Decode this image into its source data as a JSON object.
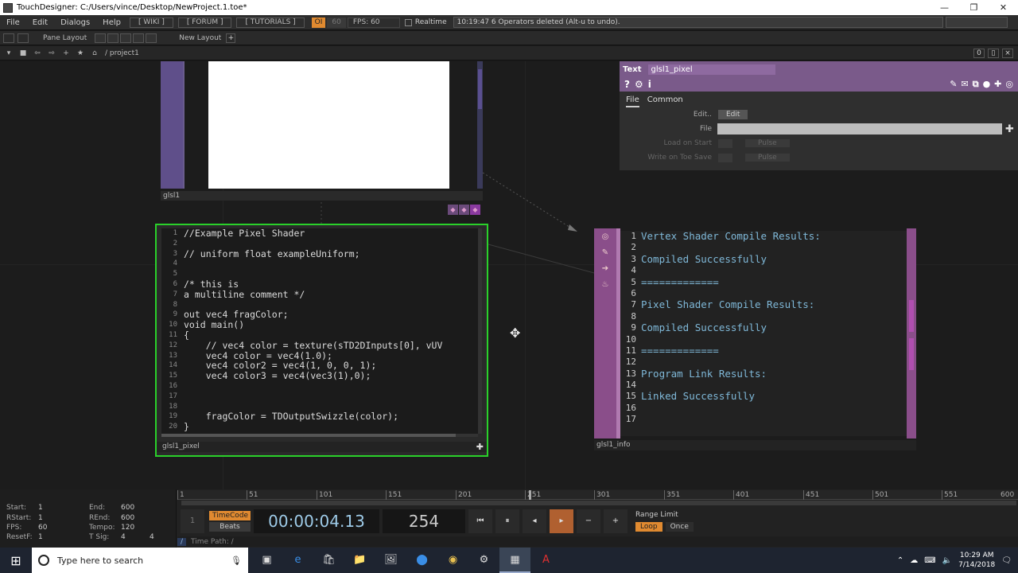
{
  "window": {
    "title": "TouchDesigner: C:/Users/vince/Desktop/NewProject.1.toe*",
    "controls": [
      "—",
      "❐",
      "✕"
    ]
  },
  "menu": {
    "items": [
      "File",
      "Edit",
      "Dialogs",
      "Help"
    ],
    "links": [
      "[ WIKI ]",
      "[ FORUM ]",
      "[ TUTORIALS ]"
    ],
    "oi": "OI",
    "sixty": "60",
    "fps": "FPS:  60",
    "realtime": "Realtime",
    "message": "10:19:47 6 Operators deleted (Alt-u to undo)."
  },
  "panebar": {
    "pane_layout": "Pane Layout",
    "new_layout": "New Layout",
    "plus": "+"
  },
  "pathbar": {
    "path": "/ project1",
    "zero": "0"
  },
  "nodes": {
    "glsl1": {
      "label": "glsl1"
    },
    "glsl1_pixel": {
      "label": "glsl1_pixel",
      "lines": [
        {
          "n": "1",
          "t": "//Example Pixel Shader"
        },
        {
          "n": "2",
          "t": ""
        },
        {
          "n": "3",
          "t": "// uniform float exampleUniform;"
        },
        {
          "n": "4",
          "t": ""
        },
        {
          "n": "5",
          "t": ""
        },
        {
          "n": "6",
          "t": "/* this is"
        },
        {
          "n": "7",
          "t": "a multiline comment */"
        },
        {
          "n": "8",
          "t": ""
        },
        {
          "n": "9",
          "t": "out vec4 fragColor;"
        },
        {
          "n": "10",
          "t": "void main()"
        },
        {
          "n": "11",
          "t": "{"
        },
        {
          "n": "12",
          "t": "    // vec4 color = texture(sTD2DInputs[0], vUV"
        },
        {
          "n": "13",
          "t": "    vec4 color = vec4(1.0);"
        },
        {
          "n": "14",
          "t": "    vec4 color2 = vec4(1, 0, 0, 1);"
        },
        {
          "n": "15",
          "t": "    vec4 color3 = vec4(vec3(1),0);"
        },
        {
          "n": "16",
          "t": ""
        },
        {
          "n": "17",
          "t": ""
        },
        {
          "n": "18",
          "t": ""
        },
        {
          "n": "19",
          "t": "    fragColor = TDOutputSwizzle(color);"
        },
        {
          "n": "20",
          "t": "}"
        }
      ]
    },
    "glsl1_info": {
      "label": "glsl1_info",
      "lines": [
        {
          "n": "1",
          "t": "Vertex Shader Compile Results:"
        },
        {
          "n": "2",
          "t": ""
        },
        {
          "n": "3",
          "t": "Compiled Successfully"
        },
        {
          "n": "4",
          "t": ""
        },
        {
          "n": "5",
          "t": "============="
        },
        {
          "n": "6",
          "t": ""
        },
        {
          "n": "7",
          "t": "Pixel Shader Compile Results:"
        },
        {
          "n": "8",
          "t": ""
        },
        {
          "n": "9",
          "t": "Compiled Successfully"
        },
        {
          "n": "10",
          "t": ""
        },
        {
          "n": "11",
          "t": "============="
        },
        {
          "n": "12",
          "t": ""
        },
        {
          "n": "13",
          "t": "Program Link Results:"
        },
        {
          "n": "14",
          "t": ""
        },
        {
          "n": "15",
          "t": "Linked Successfully"
        },
        {
          "n": "16",
          "t": ""
        },
        {
          "n": "17",
          "t": ""
        }
      ]
    }
  },
  "params": {
    "type": "Text",
    "name": "glsl1_pixel",
    "tabs": [
      "File",
      "Common"
    ],
    "edit_label": "Edit..",
    "edit_button": "Edit",
    "file_label": "File",
    "load_on_start": "Load on Start",
    "write_on_save": "Write on Toe Save",
    "pulse": "Pulse"
  },
  "timeline": {
    "stats": [
      {
        "k": "Start:",
        "v": "1"
      },
      {
        "k": "RStart:",
        "v": "1"
      },
      {
        "k": "FPS:",
        "v": "60"
      },
      {
        "k": "ResetF:",
        "v": "1"
      },
      {
        "k": "End:",
        "v": "600"
      },
      {
        "k": "REnd:",
        "v": "600"
      },
      {
        "k": "Tempo:",
        "v": "120"
      },
      {
        "k": "T Sig:",
        "v": "4"
      },
      {
        "k": "",
        "v": "4"
      }
    ],
    "ticks": [
      "1",
      "51",
      "101",
      "151",
      "201",
      "251",
      "301",
      "351",
      "401",
      "451",
      "501",
      "551",
      "600"
    ],
    "one": "1",
    "timecode": "TimeCode",
    "beats": "Beats",
    "time": "00:00:04.13",
    "frame": "254",
    "range_limit": "Range Limit",
    "loop": "Loop",
    "once": "Once",
    "time_path": "Time Path: /",
    "slash": "/"
  },
  "taskbar": {
    "search_placeholder": "Type here to search",
    "time": "10:29 AM",
    "date": "7/14/2018"
  }
}
